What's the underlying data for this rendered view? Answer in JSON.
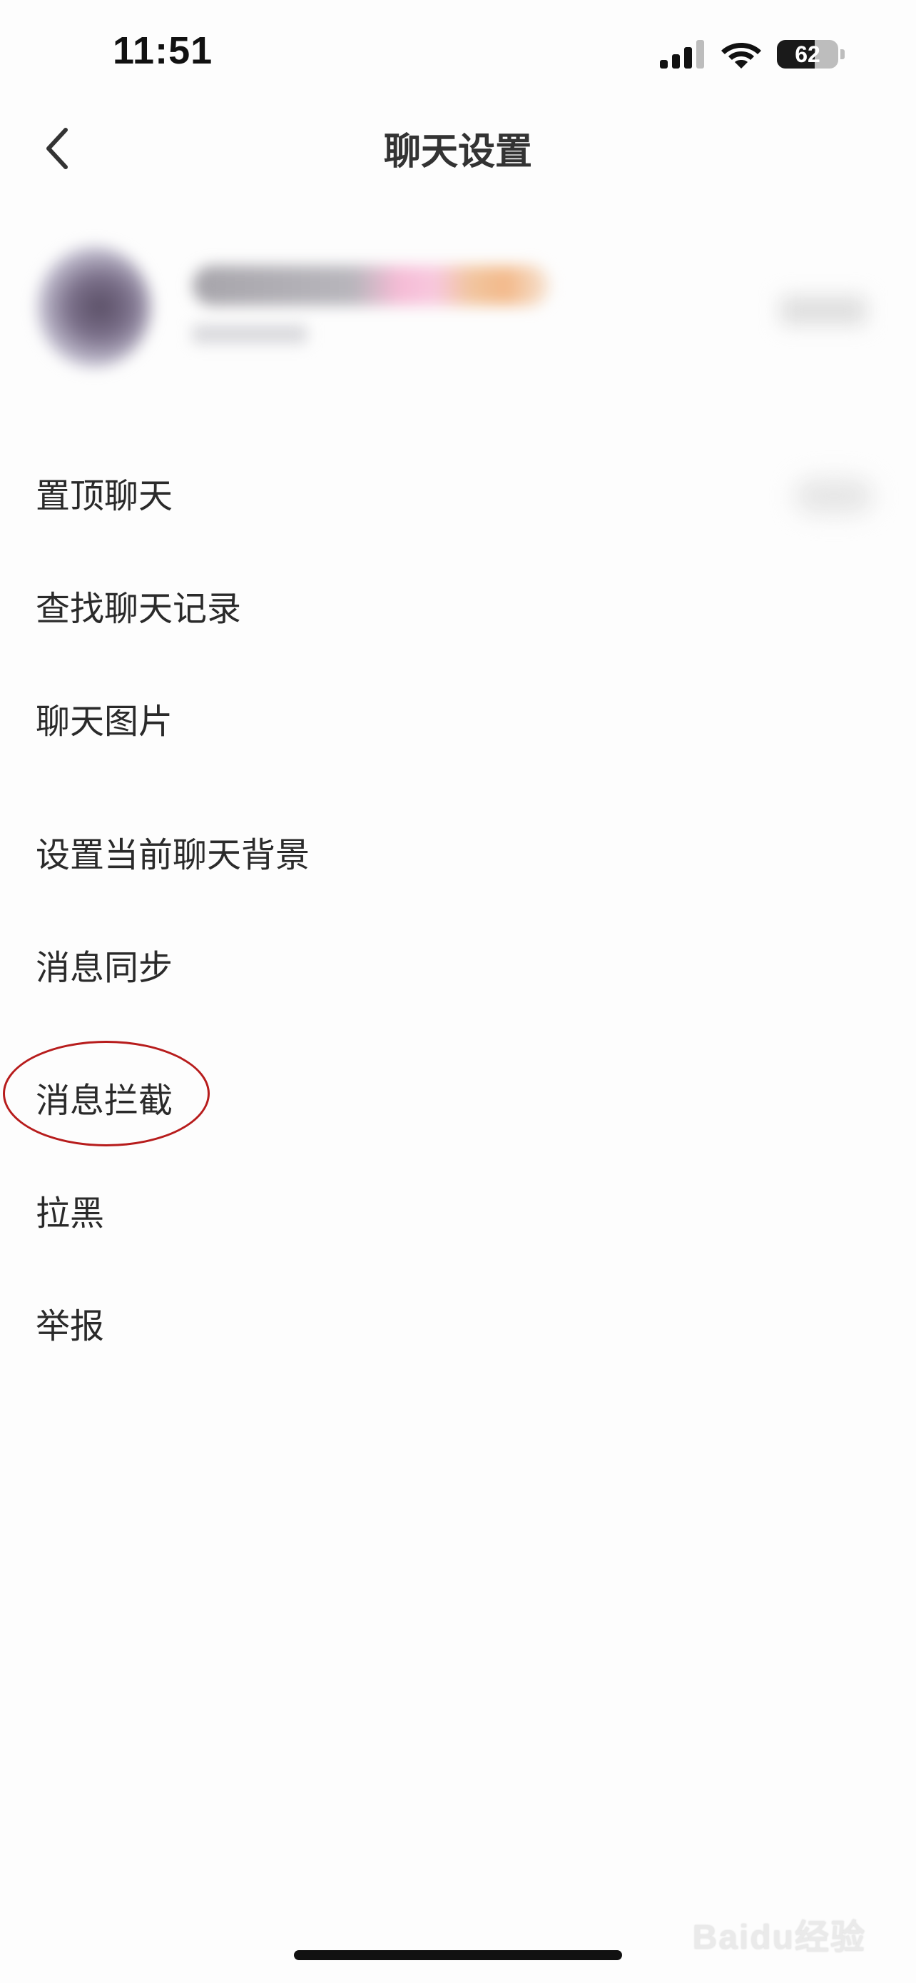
{
  "status_bar": {
    "time": "11:51",
    "battery_level": "62",
    "battery_percent": 62,
    "icons": [
      "signal-icon",
      "wifi-icon",
      "battery-icon"
    ]
  },
  "nav": {
    "back_icon": "chevron-left-icon",
    "title": "聊天设置"
  },
  "menu": {
    "items": [
      {
        "label": "置顶聊天"
      },
      {
        "label": "查找聊天记录"
      },
      {
        "label": "聊天图片"
      },
      {
        "label": "设置当前聊天背景"
      },
      {
        "label": "消息同步"
      },
      {
        "label": "消息拦截"
      },
      {
        "label": "拉黑"
      },
      {
        "label": "举报"
      }
    ]
  },
  "watermark": {
    "text": "Baidu经验"
  },
  "colors": {
    "background": "#fdfdfd",
    "text": "#2a2a2a",
    "highlight": "#b71c1c"
  }
}
